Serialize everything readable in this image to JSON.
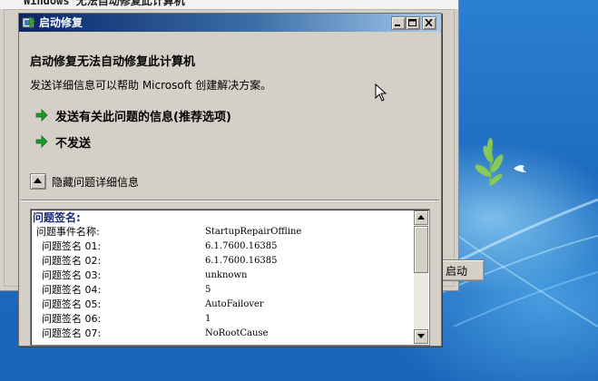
{
  "background_window": {
    "title": "Windows 无法自动修复此计算机",
    "restart_button_label": "启动"
  },
  "dialog": {
    "title": "启动修复",
    "heading": "启动修复无法自动修复此计算机",
    "description": "发送详细信息可以帮助 Microsoft 创建解决方案。",
    "options": [
      {
        "label": "发送有关此问题的信息(推荐选项)",
        "icon": "green-arrow-icon"
      },
      {
        "label": "不发送",
        "icon": "green-arrow-icon"
      }
    ],
    "details_toggle_label": "隐藏问题详细信息",
    "details": {
      "header": "问题签名:",
      "rows": [
        {
          "key": "问题事件名称:",
          "value": "StartupRepairOffline"
        },
        {
          "key": "问题签名 01:",
          "value": "6.1.7600.16385"
        },
        {
          "key": "问题签名 02:",
          "value": "6.1.7600.16385"
        },
        {
          "key": "问题签名 03:",
          "value": "unknown"
        },
        {
          "key": "问题签名 04:",
          "value": "5"
        },
        {
          "key": "问题签名 05:",
          "value": "AutoFailover"
        },
        {
          "key": "问题签名 06:",
          "value": "1"
        },
        {
          "key": "问题签名 07:",
          "value": "NoRootCause"
        }
      ]
    }
  },
  "colors": {
    "titlebar_start": "#0a246a",
    "titlebar_end": "#a6caf0",
    "dialog_bg": "#d4d0c8",
    "arrow_green": "#1f9a2a",
    "desktop_blue": "#1f6fc0"
  }
}
